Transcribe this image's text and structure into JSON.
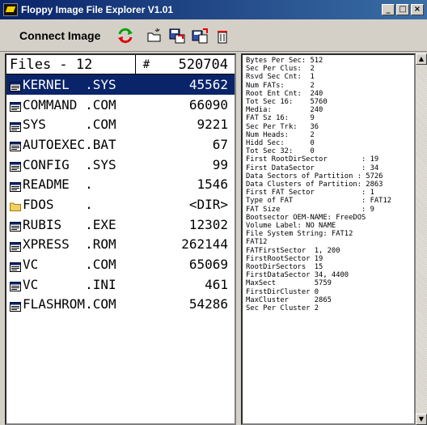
{
  "window": {
    "title": "Floppy Image File Explorer V1.01",
    "minimize": "_",
    "maximize": "□",
    "close": "×"
  },
  "toolbar": {
    "connect_label": "Connect Image",
    "icons": [
      "refresh-icon",
      "new-folder-icon",
      "add-file-icon",
      "extract-file-icon",
      "delete-icon"
    ]
  },
  "files": {
    "header_label": "Files - 12",
    "hash_label": "#",
    "total_size": "520704",
    "rows": [
      {
        "name": "KERNEL  .SYS",
        "size": "45562",
        "type": "file"
      },
      {
        "name": "COMMAND .COM",
        "size": "66090",
        "type": "file"
      },
      {
        "name": "SYS     .COM",
        "size": "9221",
        "type": "file"
      },
      {
        "name": "AUTOEXEC.BAT",
        "size": "67",
        "type": "file"
      },
      {
        "name": "CONFIG  .SYS",
        "size": "99",
        "type": "file"
      },
      {
        "name": "README  .",
        "size": "1546",
        "type": "file"
      },
      {
        "name": "FDOS    .",
        "size": "<DIR>",
        "type": "dir"
      },
      {
        "name": "RUBIS   .EXE",
        "size": "12302",
        "type": "file"
      },
      {
        "name": "XPRESS  .ROM",
        "size": "262144",
        "type": "file"
      },
      {
        "name": "VC      .COM",
        "size": "65069",
        "type": "file"
      },
      {
        "name": "VC      .INI",
        "size": "461",
        "type": "file"
      },
      {
        "name": "FLASHROM.COM",
        "size": "54286",
        "type": "file"
      }
    ]
  },
  "info": {
    "lines": [
      "Bytes Per Sec: 512",
      "Sec Per Clus:  2",
      "Rsvd Sec Cnt:  1",
      "Num FATs:      2",
      "Root Ent Cnt:  240",
      "Tot Sec 16:    5760",
      "Media:         240",
      "FAT Sz 16:     9",
      "Sec Per Trk:   36",
      "Num Heads:     2",
      "Hidd Sec:      0",
      "Tot Sec 32:    0",
      "First RootDirSector        : 19",
      "First DataSector           : 34",
      "Data Sectors of Partition : 5726",
      "Data Clusters of Partition: 2863",
      "First FAT Sector           : 1",
      "Type of FAT                : FAT12",
      "FAT Size                   : 9",
      "Bootsector OEM-NAME: FreeDOS",
      "Volume Label: NO NAME",
      "File System String: FAT12",
      "FAT12",
      "FATFirstSector  1, 200",
      "FirstRootSector 19",
      "RootDirSectors  15",
      "FirstDataSector 34, 4400",
      "MaxSect         5759",
      "FirstDirCluster 0",
      "MaxCluster      2865",
      "Sec Per Cluster 2"
    ]
  },
  "colors": {
    "selection": "#0a246a",
    "title_start": "#0a246a",
    "title_end": "#3a6ea5",
    "face": "#d4d0c8"
  }
}
